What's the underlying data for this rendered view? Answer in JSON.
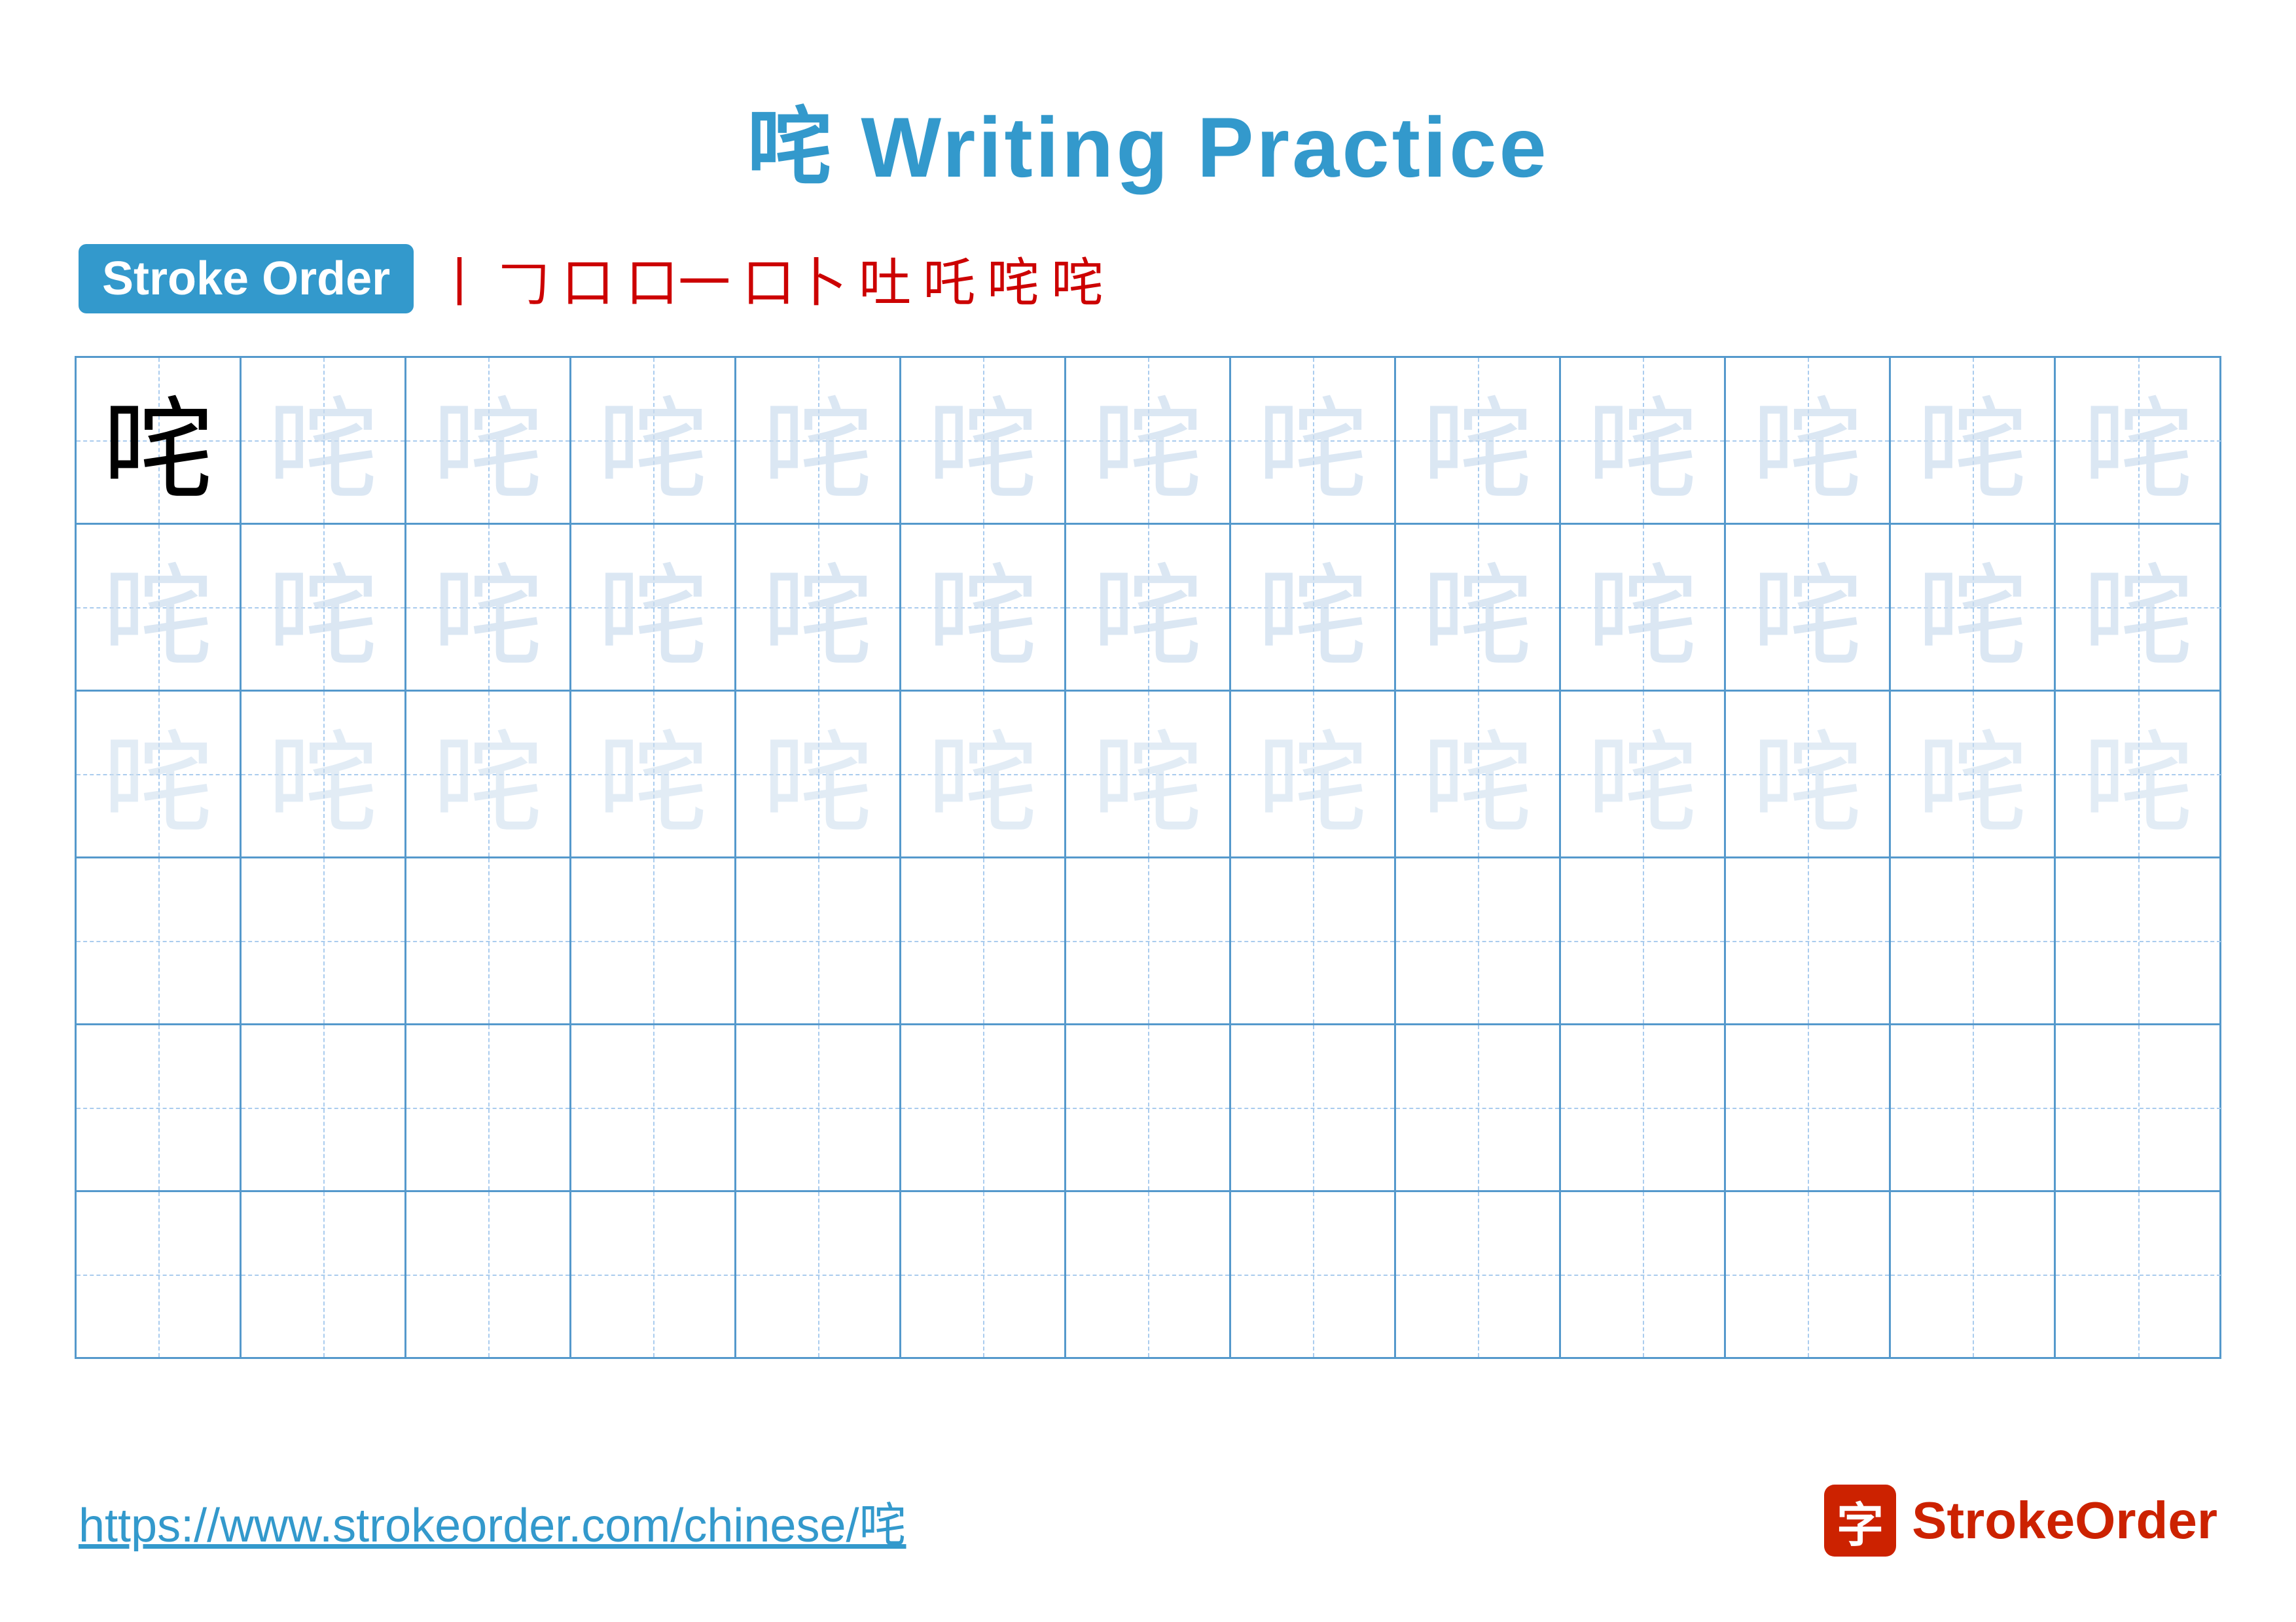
{
  "title": {
    "char": "咤",
    "text": "Writing Practice",
    "full": "咤 Writing Practice"
  },
  "stroke_order": {
    "badge": "Stroke Order",
    "steps": [
      "丨",
      "𠃌",
      "口",
      "口一",
      "口卜",
      "吐",
      "吒",
      "咤",
      "咤"
    ]
  },
  "grid": {
    "rows": 6,
    "cols": 13,
    "char": "咤",
    "row1_type": "trace_dark",
    "row2_type": "trace_light",
    "row3_type": "trace_lighter",
    "row4_type": "empty",
    "row5_type": "empty",
    "row6_type": "empty"
  },
  "footer": {
    "url": "https://www.strokeorder.com/chinese/咤",
    "logo_char": "字",
    "logo_name": "StrokeOrder"
  }
}
